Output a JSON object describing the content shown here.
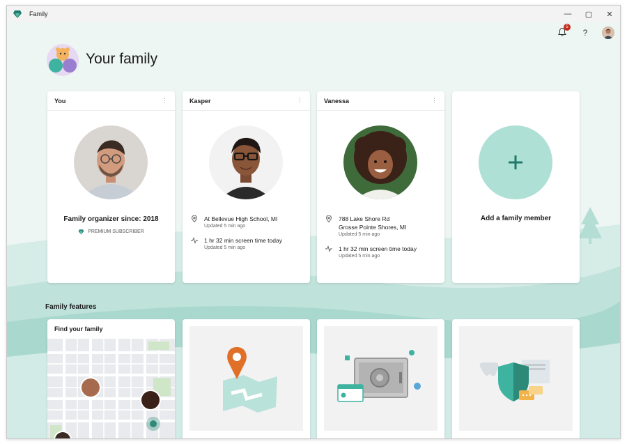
{
  "window": {
    "title": "Family",
    "controls": {
      "minimize": "—",
      "maximize": "▢",
      "close": "✕"
    }
  },
  "topbar": {
    "notifications": {
      "icon": "bell-icon",
      "count": "5"
    },
    "help": "?",
    "profile_icon": "avatar"
  },
  "header": {
    "title": "Your family"
  },
  "members": [
    {
      "name": "You",
      "organizer": "Family organizer since: 2018",
      "subscription": "PREMIUM SUBSCRIBER"
    },
    {
      "name": "Kasper",
      "location": "At Bellevue High School, MI",
      "location_updated": "Updated 5 min ago",
      "screen_time": "1 hr 32 min screen time today",
      "screen_time_updated": "Updated 5 min ago"
    },
    {
      "name": "Vanessa",
      "location_line1": "788 Lake Shore Rd",
      "location_line2": "Grosse Pointe Shores, MI",
      "location_updated": "Updated 5 min ago",
      "screen_time": "1 hr 32 min screen time today",
      "screen_time_updated": "Updated 5 min ago"
    }
  ],
  "add_member": {
    "label": "Add a family member",
    "icon": "plus-icon"
  },
  "features": {
    "title": "Family features",
    "items": [
      {
        "title": "Find your family",
        "icon": "map-icon"
      },
      {
        "title": "",
        "icon": "location-pin-icon"
      },
      {
        "title": "",
        "icon": "safe-icon"
      },
      {
        "title": "",
        "icon": "shield-icon"
      }
    ]
  },
  "colors": {
    "accent": "#2d8a78",
    "teal_light": "#aee0d6",
    "background": "#eef6f4",
    "badge": "#c42b1c",
    "pin": "#e07028"
  }
}
